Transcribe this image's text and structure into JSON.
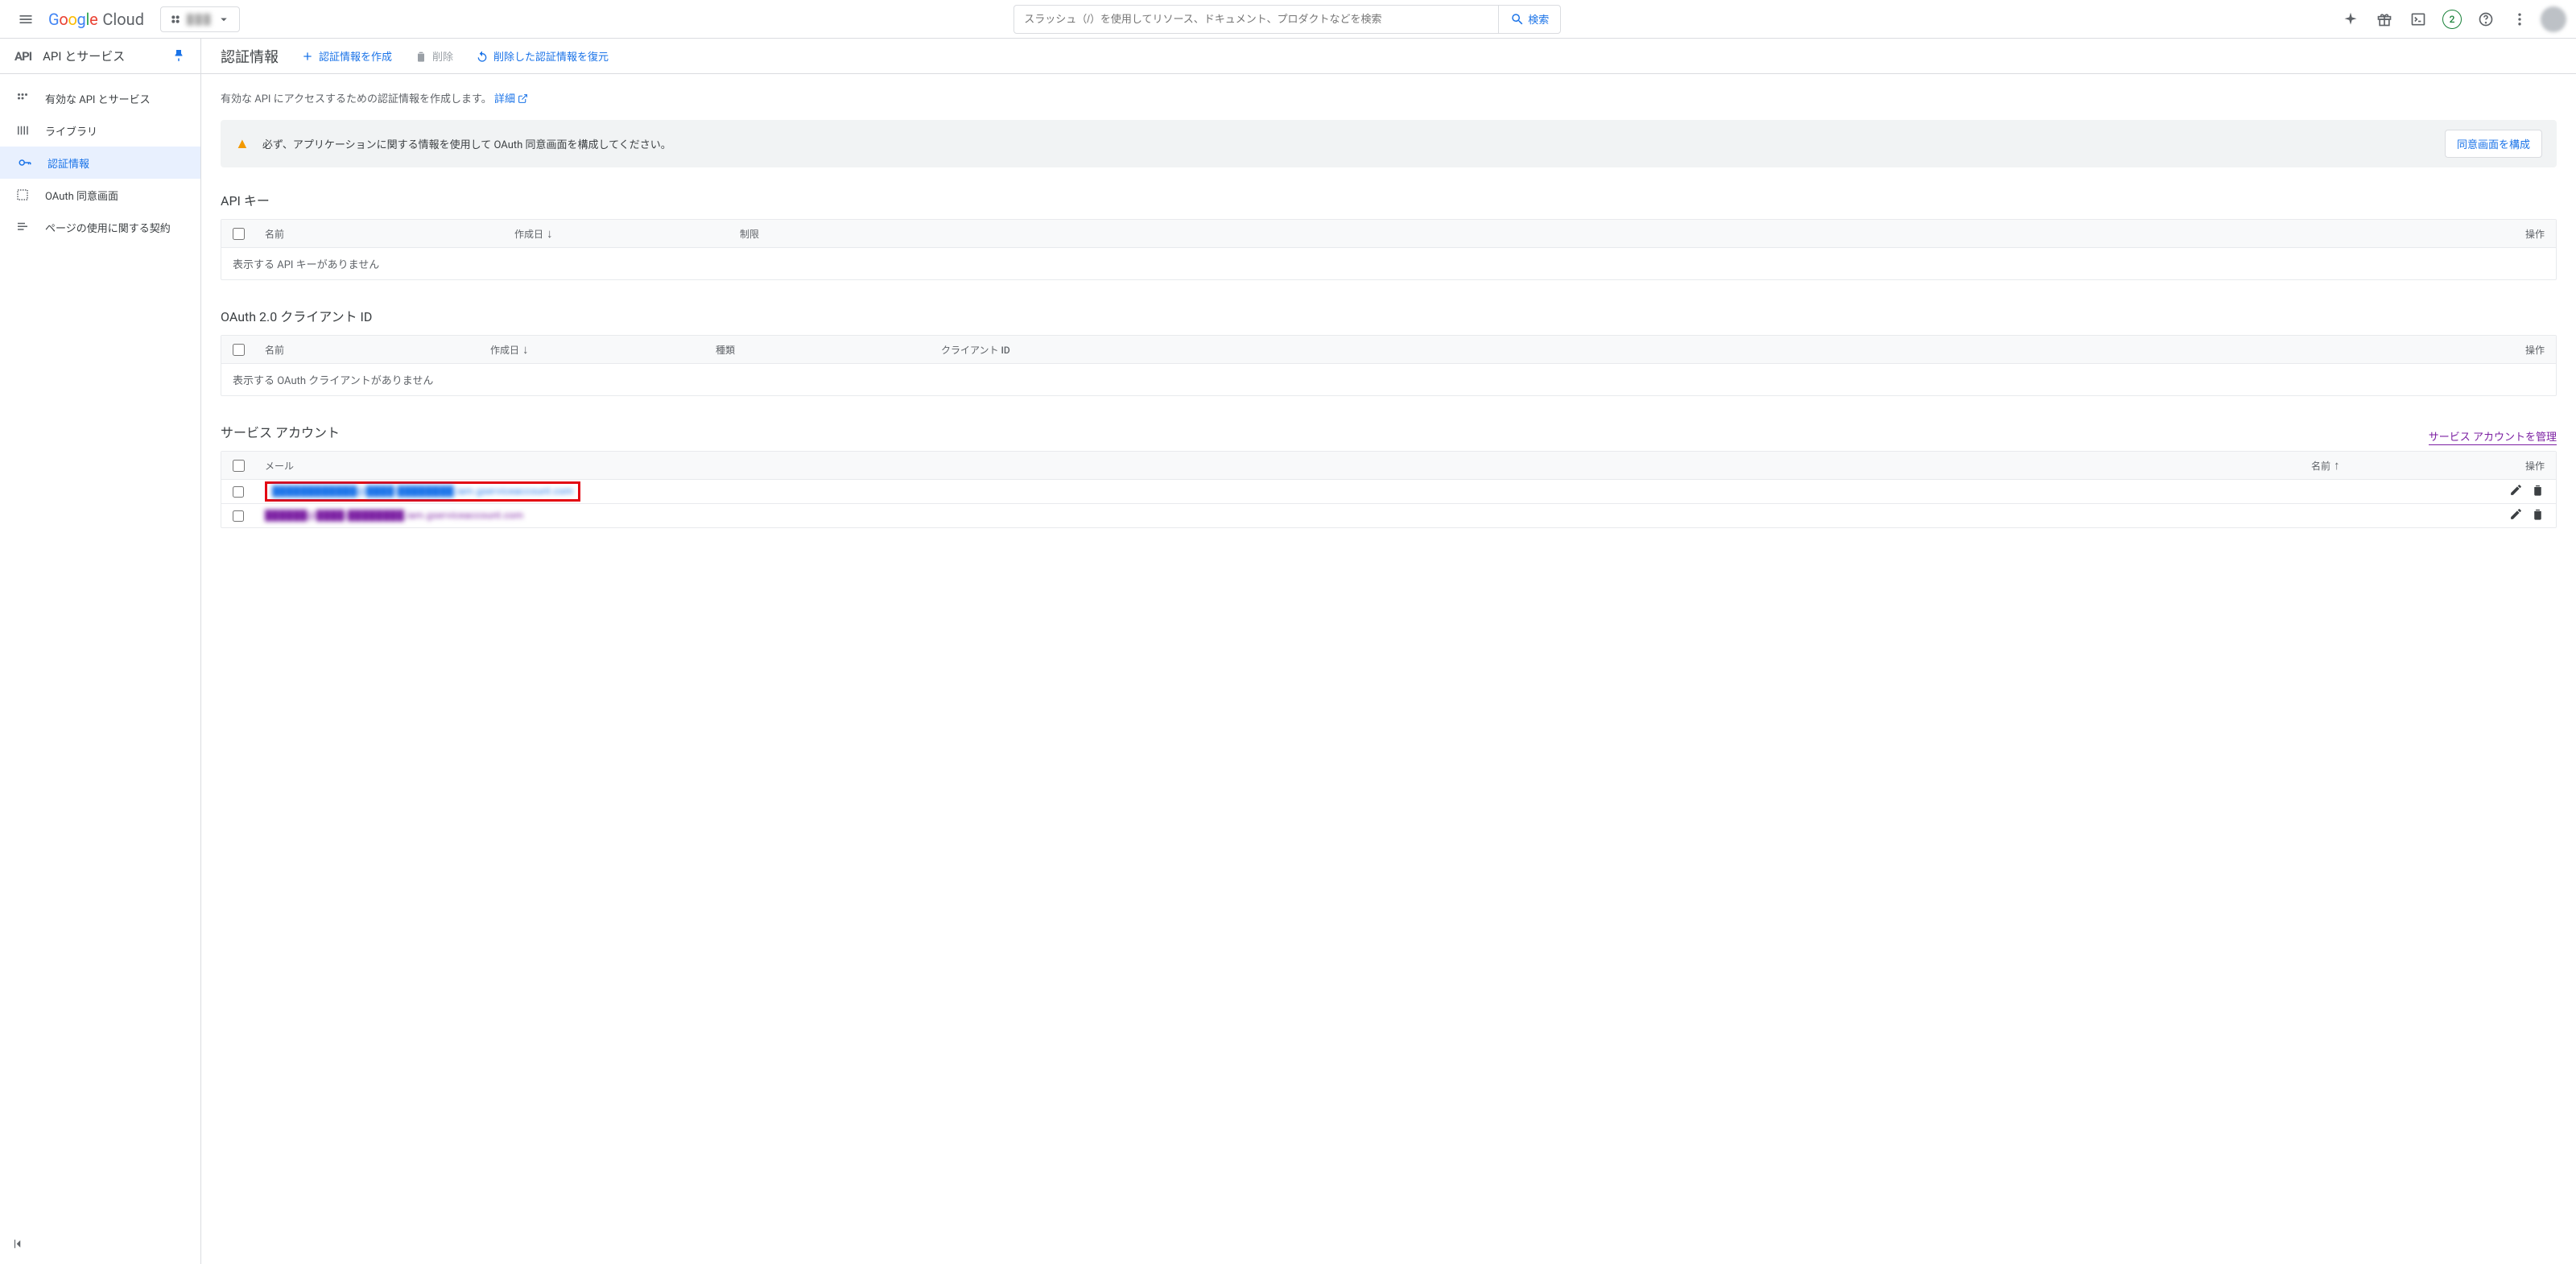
{
  "header": {
    "logo_cloud": "Cloud",
    "search_placeholder": "スラッシュ（/）を使用してリソース、ドキュメント、プロダクトなどを検索",
    "search_button": "検索",
    "trial_count": "2",
    "project_redacted": "███"
  },
  "sidebar": {
    "api_icon": "API",
    "title": "API とサービス",
    "items": [
      {
        "label": "有効な API とサービス"
      },
      {
        "label": "ライブラリ"
      },
      {
        "label": "認証情報"
      },
      {
        "label": "OAuth 同意画面"
      },
      {
        "label": "ページの使用に関する契約"
      }
    ]
  },
  "page_header": {
    "title": "認証情報",
    "create": "認証情報を作成",
    "delete": "削除",
    "restore": "削除した認証情報を復元"
  },
  "description": {
    "text": "有効な API にアクセスするための認証情報を作成します。",
    "details": "詳細"
  },
  "alert": {
    "text": "必ず、アプリケーションに関する情報を使用して OAuth 同意画面を構成してください。",
    "button": "同意画面を構成"
  },
  "api_keys": {
    "title": "API キー",
    "th_name": "名前",
    "th_date": "作成日",
    "th_restrict": "制限",
    "th_actions": "操作",
    "empty": "表示する API キーがありません"
  },
  "oauth": {
    "title": "OAuth 2.0 クライアント ID",
    "th_name": "名前",
    "th_date": "作成日",
    "th_kind": "種類",
    "th_clientid": "クライアント ID",
    "th_actions": "操作",
    "empty": "表示する OAuth クライアントがありません"
  },
  "service_accounts": {
    "title": "サービス アカウント",
    "manage": "サービス アカウントを管理",
    "th_email": "メール",
    "th_name": "名前",
    "th_actions": "操作",
    "rows": [
      {
        "email": "████████████@████-████████.iam.gserviceaccount.com",
        "highlighted": true
      },
      {
        "email": "██████@████-████████.iam.gserviceaccount.com",
        "highlighted": false
      }
    ]
  }
}
